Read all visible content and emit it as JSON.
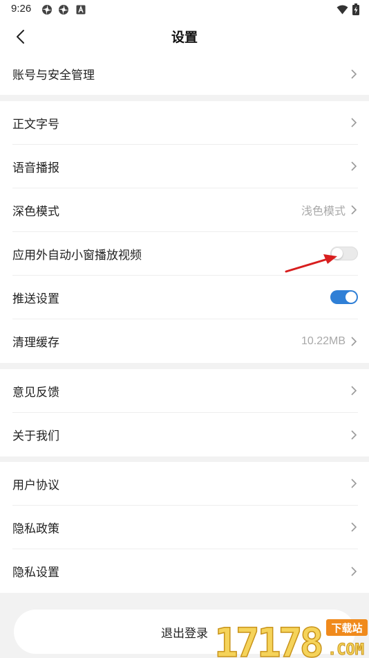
{
  "status_bar": {
    "time": "9:26"
  },
  "header": {
    "title": "设置"
  },
  "groups": [
    {
      "items": [
        {
          "label": "账号与安全管理"
        }
      ]
    },
    {
      "items": [
        {
          "label": "正文字号"
        },
        {
          "label": "语音播报"
        },
        {
          "label": "深色模式",
          "value": "浅色模式"
        },
        {
          "label": "应用外自动小窗播放视频",
          "toggle": false
        },
        {
          "label": "推送设置",
          "toggle": true
        },
        {
          "label": "清理缓存",
          "value": "10.22MB"
        }
      ]
    },
    {
      "items": [
        {
          "label": "意见反馈"
        },
        {
          "label": "关于我们"
        }
      ]
    },
    {
      "items": [
        {
          "label": "用户协议"
        },
        {
          "label": "隐私政策"
        },
        {
          "label": "隐私设置"
        }
      ]
    }
  ],
  "logout": {
    "label": "退出登录"
  },
  "watermark": {
    "number": "17178",
    "badge": "下载站",
    "domain": ".COM"
  },
  "colors": {
    "accent": "#2f7fd6",
    "annotation_arrow": "#d81e1e"
  }
}
